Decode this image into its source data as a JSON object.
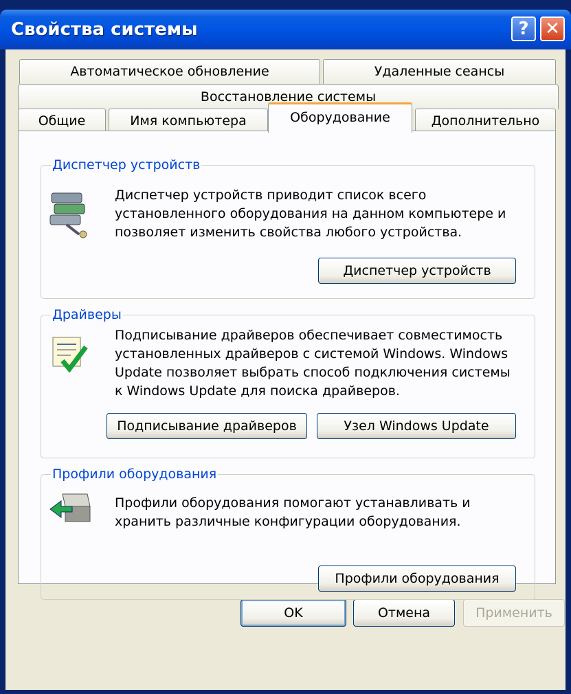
{
  "window": {
    "title": "Свойства системы",
    "help_glyph": "?",
    "close_glyph": "✕"
  },
  "tabs": [
    {
      "label": "Автоматическое обновление"
    },
    {
      "label": "Удаленные сеансы"
    },
    {
      "label": "Восстановление системы"
    },
    {
      "label": "Общие"
    },
    {
      "label": "Имя компьютера"
    },
    {
      "label": "Оборудование"
    },
    {
      "label": "Дополнительно"
    }
  ],
  "active_tab": "Оборудование",
  "device_manager": {
    "legend": "Диспетчер устройств",
    "line1": "Диспетчер устройств приводит список всего",
    "line2": "установленного оборудования на данном компьютере и",
    "line3": "позволяет изменить свойства любого устройства.",
    "button": "Диспетчер устройств",
    "icon": "device-manager-icon"
  },
  "drivers": {
    "legend": "Драйверы",
    "line1": "Подписывание драйверов обеспечивает совместимость",
    "line2": "установленных драйверов с системой Windows.  Windows",
    "line3": "Update позволяет выбрать способ подключения системы",
    "line4": "к Windows Update для поиска драйверов.",
    "signing_button": "Подписывание драйверов",
    "update_button": "Узел Windows Update",
    "icon": "driver-signing-icon"
  },
  "hardware_profiles": {
    "legend": "Профили оборудования",
    "line1": "Профили оборудования помогают устанавливать и",
    "line2": "хранить различные конфигурации оборудования.",
    "button": "Профили оборудования",
    "icon": "hardware-profiles-icon"
  },
  "footer": {
    "ok": "OK",
    "cancel": "Отмена",
    "apply": "Применить"
  },
  "colors": {
    "titlebar": "#0054e3",
    "client": "#ece9d8",
    "legend": "#0046d5",
    "active_tab_accent": "#f2a640"
  }
}
